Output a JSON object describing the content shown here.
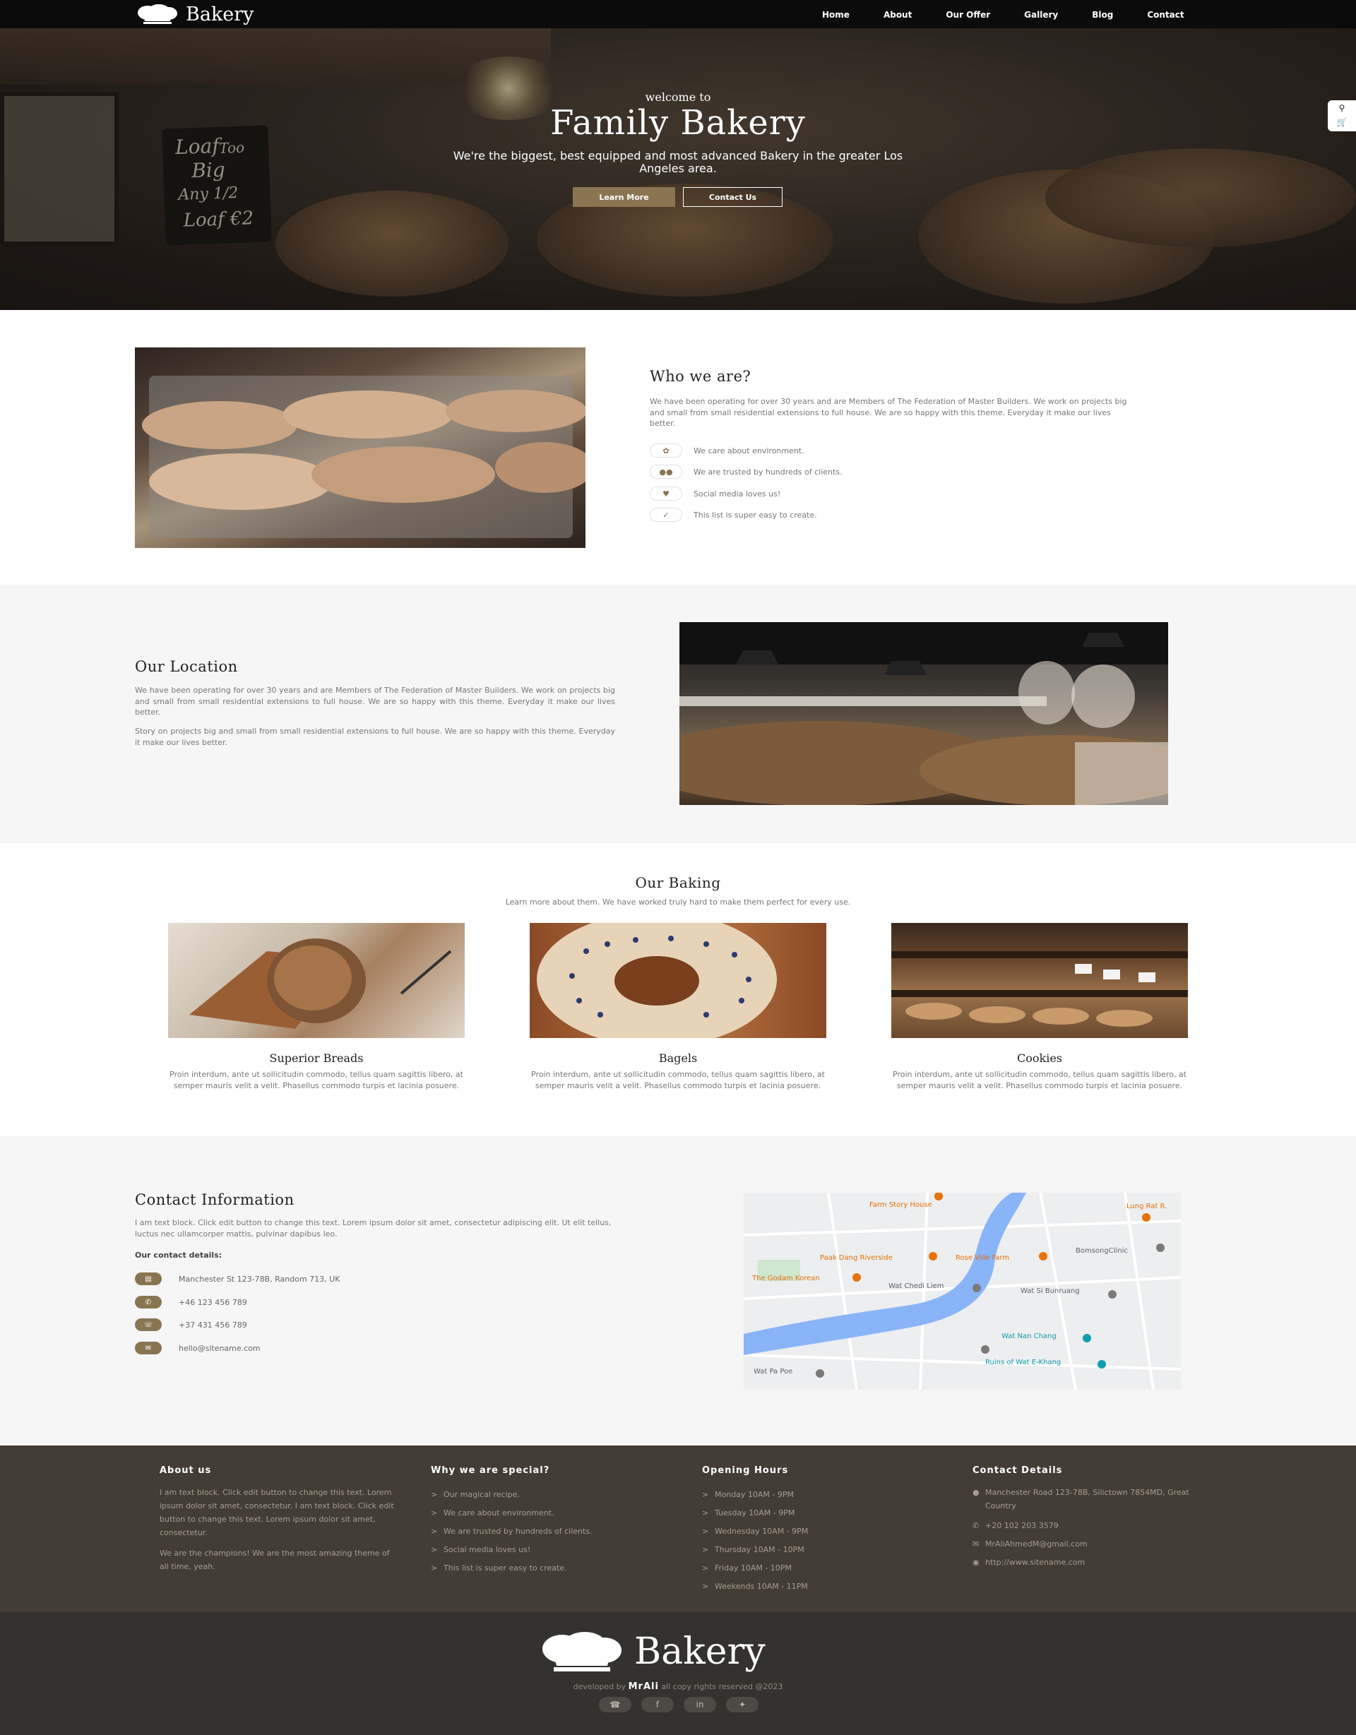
{
  "nav": {
    "brand": "Bakery",
    "items": [
      "Home",
      "About",
      "Our Offer",
      "Gallery",
      "Blog",
      "Contact"
    ]
  },
  "hero": {
    "welcome": "welcome to",
    "title": "Family Bakery",
    "subtitle": "We're the biggest, best equipped and most advanced Bakery in the greater Los Angeles area.",
    "btn_primary": "Learn More",
    "btn_secondary": "Contact Us",
    "chalkboard": [
      "Loaf",
      "Too",
      "Big",
      "Any 1/2",
      "Loaf €2"
    ],
    "tools": [
      "search-icon",
      "cart-icon"
    ]
  },
  "who": {
    "title": "Who we are?",
    "text": "We have been operating for over 30 years and are Members of The Federation of Master Builders. We work on projects big and small from small residential extensions to full house. We are so happy with this theme. Everyday it make our lives better.",
    "features": [
      {
        "icon": "leaf-icon",
        "label": "We care about environment."
      },
      {
        "icon": "users-icon",
        "label": "We are trusted by hundreds of clients."
      },
      {
        "icon": "heart-icon",
        "label": "Social media loves us!"
      },
      {
        "icon": "check-icon",
        "label": "This list is super easy to create."
      }
    ]
  },
  "location": {
    "title": "Our Location",
    "p1": "We have been operating for over 30 years and are Members of The Federation of Master Builders. We work on projects big and small from small residential extensions to full house. We are so happy with this theme. Everyday it make our lives better.",
    "p2": "Story on projects big and small from small residential extensions to full house. We are so happy with this theme. Everyday it make our lives better."
  },
  "baking": {
    "title": "Our Baking",
    "subtitle": "Learn more about them. We have worked truly hard to make them perfect for every use.",
    "cards": [
      {
        "title": "Superior Breads",
        "text": "Proin interdum, ante ut sollicitudin commodo, tellus quam sagittis libero, at semper mauris velit a velit. Phasellus commodo turpis et lacinia posuere."
      },
      {
        "title": "Bagels",
        "text": "Proin interdum, ante ut sollicitudin commodo, tellus quam sagittis libero, at semper mauris velit a velit. Phasellus commodo turpis et lacinia posuere."
      },
      {
        "title": "Cookies",
        "text": "Proin interdum, ante ut sollicitudin commodo, tellus quam sagittis libero, at semper mauris velit a velit. Phasellus commodo turpis et lacinia posuere."
      }
    ]
  },
  "contact": {
    "title": "Contact Information",
    "text": "I am text block. Click edit button to change this text. Lorem ipsum dolor sit amet, consectetur adipiscing elit. Ut elit tellus, luctus nec ullamcorper mattis, pulvinar dapibus leo.",
    "details_label": "Our contact details:",
    "rows": [
      {
        "icon": "map-icon",
        "value": "Manchester St 123-78B, Random 713, UK"
      },
      {
        "icon": "phone-icon",
        "value": "+46 123 456 789"
      },
      {
        "icon": "headset-icon",
        "value": "+37 431 456 789"
      },
      {
        "icon": "mail-icon",
        "value": "hello@sitename.com"
      }
    ],
    "map_labels": [
      "Farm Story House",
      "Lung Rat R.",
      "Paak Dang Riverside",
      "Rose Ville Farm",
      "BomsongClinic",
      "The Godam Korean",
      "Wat Chedi Liem",
      "Wat Si Bunruang",
      "Wat Nan Chang",
      "Ruins of Wat E-Khang",
      "Wat Pa Poe"
    ]
  },
  "footer": {
    "about": {
      "title": "About us",
      "p1": "I am text block. Click edit button to change this text. Lorem ipsum dolor sit amet, consectetur. I am text block. Click edit button to change this text. Lorem ipsum dolor sit amet, consectetur.",
      "p2": "We are the champions! We are the most amazing theme of all time, yeah."
    },
    "special": {
      "title": "Why we are special?",
      "items": [
        "Our magical recipe.",
        "We care about environment.",
        "We are trusted by hundreds of clients.",
        "Social media loves us!",
        "This list is super easy to create."
      ]
    },
    "hours": {
      "title": "Opening Hours",
      "items": [
        "Monday 10AM - 9PM",
        "Tuesday 10AM - 9PM",
        "Wednesday 10AM - 9PM",
        "Thursday 10AM - 10PM",
        "Friday 10AM - 10PM",
        "Weekends 10AM - 11PM"
      ]
    },
    "details": {
      "title": "Contact Details",
      "address": "Manchester Road 123-78B, Silictown 7854MD, Great Country",
      "phone": "+20 102 203 3579",
      "email": "MrAliAhmedM@gmail.com",
      "web": "http://www.sitename.com"
    },
    "bottom": {
      "brand": "Bakery",
      "credit_pre": "developed by",
      "credit_name": "MrAli",
      "credit_post": "all copy rights reserved @2023",
      "socials": [
        "whatsapp-icon",
        "facebook-icon",
        "linkedin-icon",
        "twitter-icon"
      ]
    }
  },
  "colors": {
    "accent": "#8a7552",
    "footer": "#433d35",
    "footer_bottom": "#34322f",
    "nav": "#0b0b0b",
    "section_grey": "#f6f6f6"
  }
}
